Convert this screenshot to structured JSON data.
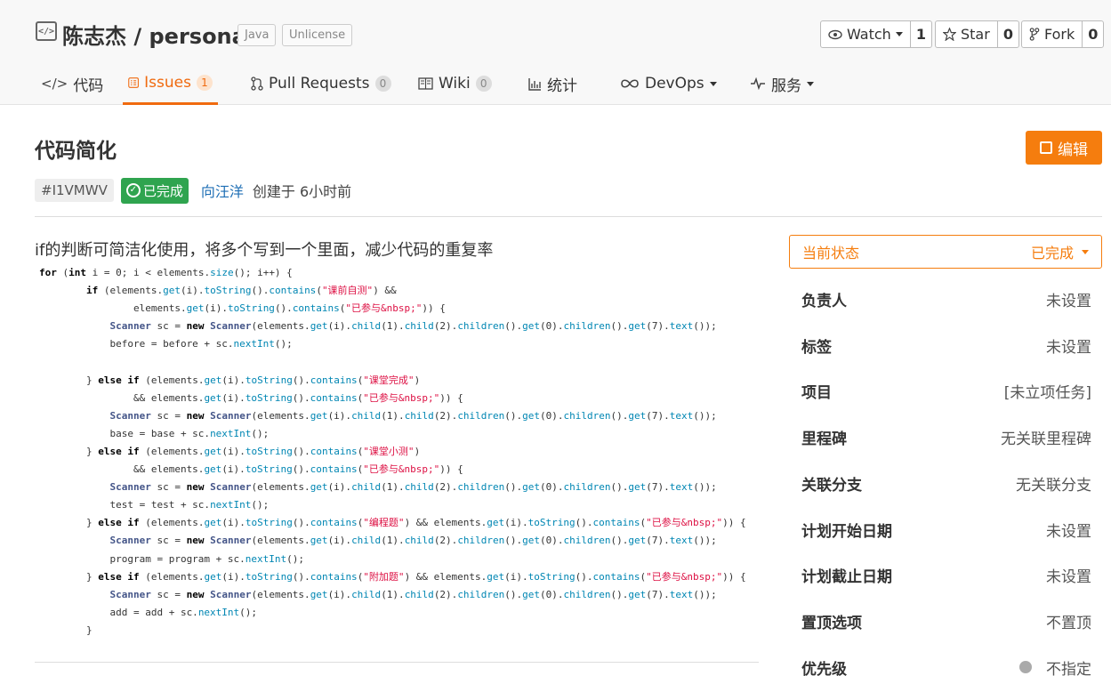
{
  "repo": {
    "owner": "陈志杰",
    "separator": "/",
    "name": "personal",
    "tags": [
      "Java",
      "Unlicense"
    ]
  },
  "actions": [
    {
      "label": "Watch",
      "count": "1",
      "icon": "eye-icon"
    },
    {
      "label": "Star",
      "count": "0",
      "icon": "star-icon"
    },
    {
      "label": "Fork",
      "count": "0",
      "icon": "fork-icon"
    }
  ],
  "tabs": [
    {
      "label": "代码",
      "icon": "code-icon"
    },
    {
      "label": "Issues",
      "badge": "1",
      "icon": "issue-icon"
    },
    {
      "label": "Pull Requests",
      "badge": "0",
      "icon": "pull-request-icon"
    },
    {
      "label": "Wiki",
      "badge": "0",
      "icon": "book-icon"
    },
    {
      "label": "统计",
      "icon": "stats-icon"
    },
    {
      "label": "DevOps",
      "icon": "infinity-icon"
    },
    {
      "label": "服务",
      "icon": "pulse-icon"
    }
  ],
  "issue": {
    "title": "代码简化",
    "edit_label": "编辑",
    "id": "#I1VMWV",
    "status": "已完成",
    "author": "向汪洋",
    "created": "创建于 6小时前",
    "description": "if的判断可简洁化使用，将多个写到一个里面，减少代码的重复率",
    "code": [
      "for (int i = 0; i < elements.size(); i++) {",
      "        if (elements.get(i).toString().contains(\"课前自测\") &&",
      "                elements.get(i).toString().contains(\"已参与&nbsp;\")) {",
      "            Scanner sc = new Scanner(elements.get(i).child(1).child(2).children().get(0).children().get(7).text());",
      "            before = before + sc.nextInt();",
      "",
      "        } else if (elements.get(i).toString().contains(\"课堂完成\")",
      "                && elements.get(i).toString().contains(\"已参与&nbsp;\")) {",
      "            Scanner sc = new Scanner(elements.get(i).child(1).child(2).children().get(0).children().get(7).text());",
      "            base = base + sc.nextInt();",
      "        } else if (elements.get(i).toString().contains(\"课堂小测\")",
      "                && elements.get(i).toString().contains(\"已参与&nbsp;\")) {",
      "            Scanner sc = new Scanner(elements.get(i).child(1).child(2).children().get(0).children().get(7).text());",
      "            test = test + sc.nextInt();",
      "        } else if (elements.get(i).toString().contains(\"编程题\") && elements.get(i).toString().contains(\"已参与&nbsp;\")) {",
      "            Scanner sc = new Scanner(elements.get(i).child(1).child(2).children().get(0).children().get(7).text());",
      "            program = program + sc.nextInt();",
      "        } else if (elements.get(i).toString().contains(\"附加题\") && elements.get(i).toString().contains(\"已参与&nbsp;\")) {",
      "            Scanner sc = new Scanner(elements.get(i).child(1).child(2).children().get(0).children().get(7).text());",
      "            add = add + sc.nextInt();",
      "        }"
    ]
  },
  "sidebar": {
    "current_status_label": "当前状态",
    "current_status_value": "已完成",
    "props": [
      {
        "label": "负责人",
        "value": "未设置"
      },
      {
        "label": "标签",
        "value": "未设置"
      },
      {
        "label": "项目",
        "value": "[未立项任务]"
      },
      {
        "label": "里程碑",
        "value": "无关联里程碑"
      },
      {
        "label": "关联分支",
        "value": "无关联分支"
      },
      {
        "label": "计划开始日期",
        "value": "未设置"
      },
      {
        "label": "计划截止日期",
        "value": "未设置"
      },
      {
        "label": "置顶选项",
        "value": "不置顶"
      },
      {
        "label": "优先级",
        "value": "不指定"
      }
    ]
  }
}
